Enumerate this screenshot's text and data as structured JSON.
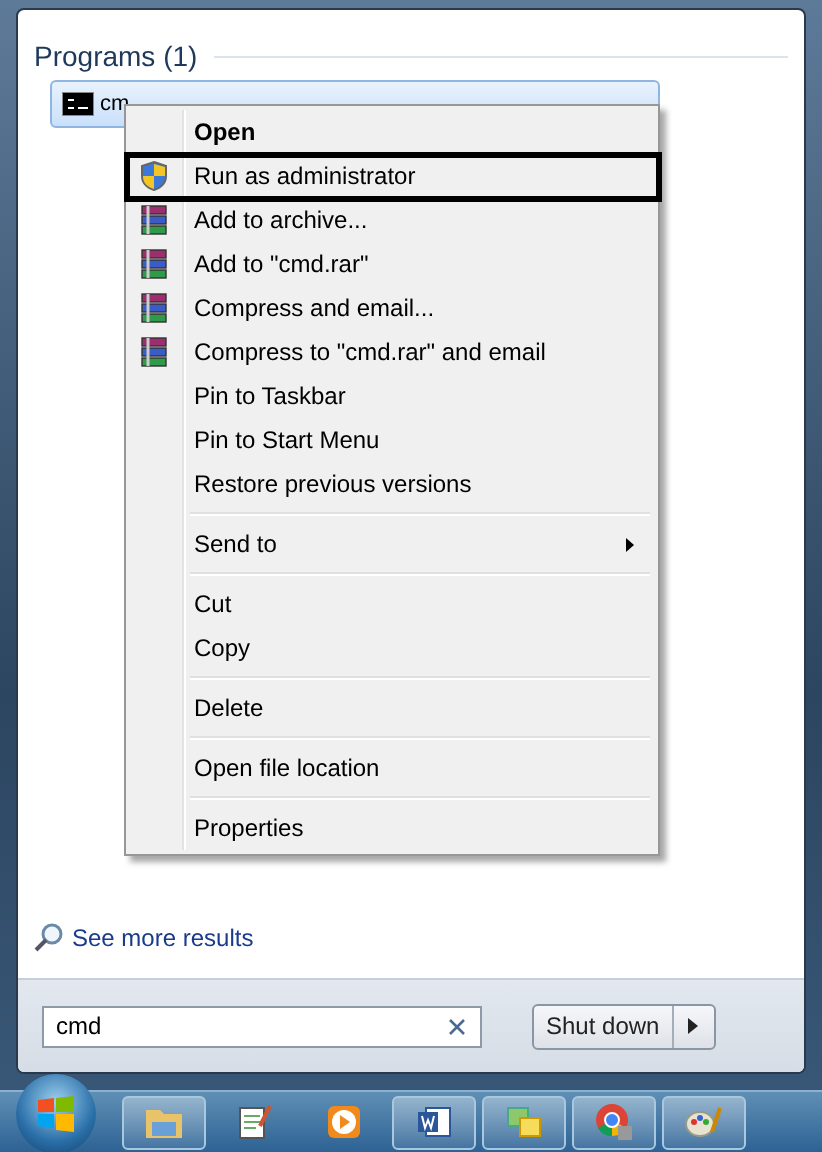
{
  "start_menu": {
    "section_title": "Programs (1)",
    "result": {
      "label": "cm",
      "selected": true
    },
    "see_more": "See more results",
    "search": {
      "value": "cmd"
    },
    "shutdown": "Shut down"
  },
  "context_menu": {
    "groups": [
      {
        "items": [
          {
            "label": "Open",
            "kind": "plain",
            "default": true,
            "outlined": false,
            "submenu": false
          },
          {
            "label": "Run as administrator",
            "kind": "shield",
            "default": false,
            "outlined": true,
            "submenu": false
          },
          {
            "label": "Add to archive...",
            "kind": "archive",
            "default": false,
            "outlined": false,
            "submenu": false
          },
          {
            "label": "Add to \"cmd.rar\"",
            "kind": "archive",
            "default": false,
            "outlined": false,
            "submenu": false
          },
          {
            "label": "Compress and email...",
            "kind": "archive",
            "default": false,
            "outlined": false,
            "submenu": false
          },
          {
            "label": "Compress to \"cmd.rar\" and email",
            "kind": "archive",
            "default": false,
            "outlined": false,
            "submenu": false
          },
          {
            "label": "Pin to Taskbar",
            "kind": "plain",
            "default": false,
            "outlined": false,
            "submenu": false
          },
          {
            "label": "Pin to Start Menu",
            "kind": "plain",
            "default": false,
            "outlined": false,
            "submenu": false
          },
          {
            "label": "Restore previous versions",
            "kind": "plain",
            "default": false,
            "outlined": false,
            "submenu": false
          }
        ]
      },
      {
        "items": [
          {
            "label": "Send to",
            "kind": "plain",
            "default": false,
            "outlined": false,
            "submenu": true
          }
        ]
      },
      {
        "items": [
          {
            "label": "Cut",
            "kind": "plain",
            "default": false,
            "outlined": false,
            "submenu": false
          },
          {
            "label": "Copy",
            "kind": "plain",
            "default": false,
            "outlined": false,
            "submenu": false
          }
        ]
      },
      {
        "items": [
          {
            "label": "Delete",
            "kind": "plain",
            "default": false,
            "outlined": false,
            "submenu": false
          }
        ]
      },
      {
        "items": [
          {
            "label": "Open file location",
            "kind": "plain",
            "default": false,
            "outlined": false,
            "submenu": false
          }
        ]
      },
      {
        "items": [
          {
            "label": "Properties",
            "kind": "plain",
            "default": false,
            "outlined": false,
            "submenu": false
          }
        ]
      }
    ]
  },
  "taskbar": [
    {
      "kind": "folder",
      "running": true
    },
    {
      "kind": "notepad",
      "running": false
    },
    {
      "kind": "player",
      "running": false
    },
    {
      "kind": "word",
      "running": true
    },
    {
      "kind": "photos",
      "running": true
    },
    {
      "kind": "browser",
      "running": true
    },
    {
      "kind": "paint",
      "running": true
    }
  ]
}
